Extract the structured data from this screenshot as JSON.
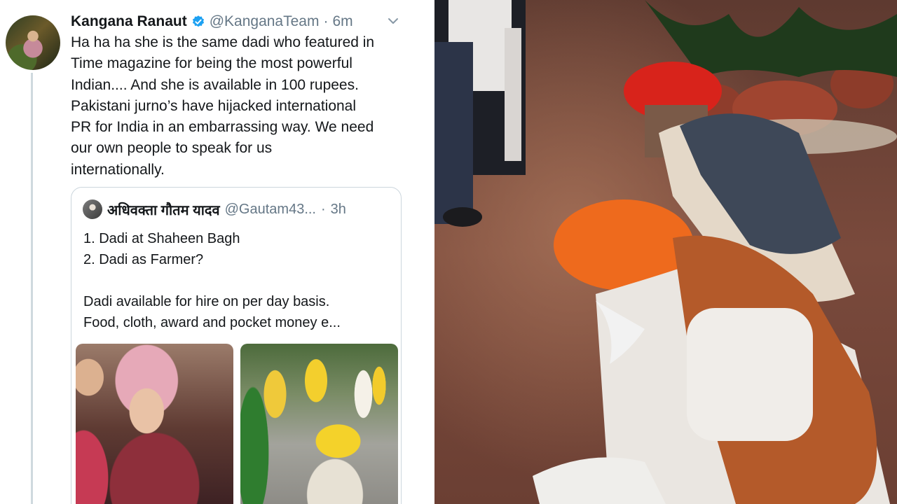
{
  "tweet": {
    "display_name": "Kangana Ranaut",
    "verified_icon": "verified-badge-icon",
    "handle": "@KanganaTeam",
    "separator": "·",
    "time": "6m",
    "menu_icon": "chevron-down-icon",
    "text_lines": [
      "Ha ha ha she is the same dadi who featured in",
      "Time magazine for being the most powerful",
      "Indian.... And she is available in 100 rupees.",
      "Pakistani jurno’s have hijacked international",
      "PR for India in an embarrassing way. We need",
      "our own people to speak for us",
      "internationally."
    ]
  },
  "quoted_tweet": {
    "display_name": "अधिवक्ता गौतम यादव",
    "handle": "@Gautam43...",
    "separator": "·",
    "time": "3h",
    "text_lines": [
      "1. Dadi at Shaheen Bagh",
      "2. Dadi as Farmer?",
      "",
      "Dadi available for hire on per day basis.",
      "Food, cloth, award and pocket money e..."
    ]
  },
  "colors": {
    "verified_blue": "#1da1f2",
    "text_primary": "#14171a",
    "text_secondary": "#657786",
    "border": "#ccd6dd"
  }
}
